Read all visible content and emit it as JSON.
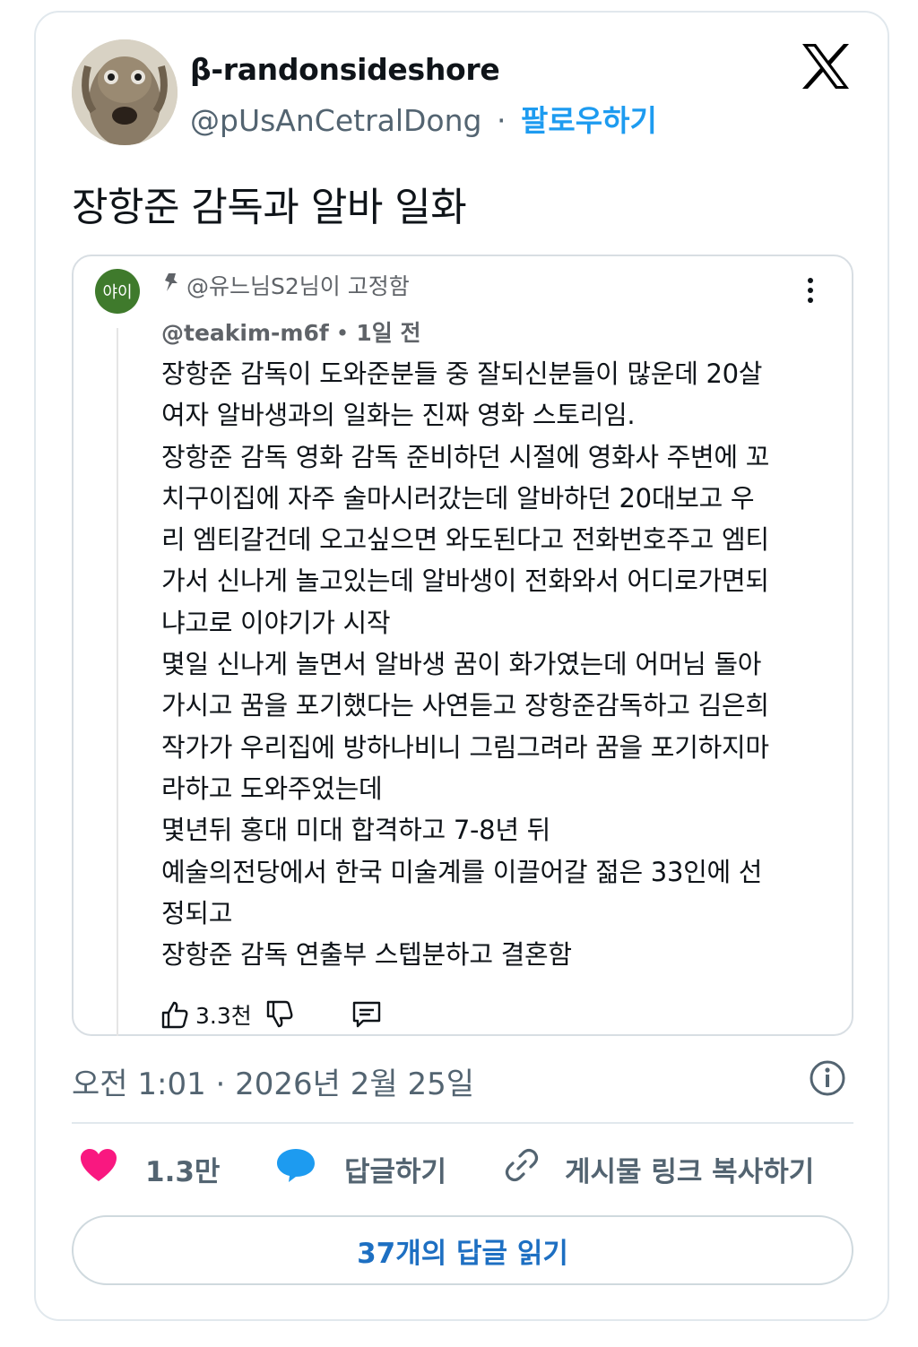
{
  "author": {
    "display_name": "β-randonsideshore",
    "handle": "@pUsAnCetralDong",
    "separator": "·",
    "follow_label": "팔로우하기"
  },
  "tweet": {
    "text": "장항준 감독과 알바 일화"
  },
  "quoted": {
    "avatar_text": "야이",
    "pinned_by": "@유느님S2님이 고정함",
    "handle": "@teakim-m6f",
    "separator": "•",
    "time": "1일 전",
    "lines": [
      "장항준 감독이 도와준분들 중 잘되신분들이 많운데 20살",
      "여자 알바생과의 일화는 진짜 영화 스토리임.",
      "장항준 감독 영화 감독 준비하던 시절에 영화사 주변에 꼬",
      "치구이집에 자주 술마시러갔는데 알바하던 20대보고 우",
      "리 엠티갈건데 오고싶으면 와도된다고 전화번호주고 엠티",
      "가서 신나게 놀고있는데 알바생이 전화와서 어디로가면되",
      "냐고로 이야기가 시작",
      "몇일 신나게 놀면서 알바생 꿈이 화가였는데 어머님 돌아",
      "가시고 꿈을 포기했다는 사연듣고 장항준감독하고 김은희",
      "작가가 우리집에 방하나비니 그림그려라 꿈을 포기하지마",
      "라하고 도와주었는데",
      "몇년뒤 홍대 미대 합격하고 7-8년 뒤",
      "예술의전당에서 한국 미술계를 이끌어갈 젊은 33인에 선",
      "정되고",
      "장항준 감독 연출부 스텝분하고 결혼함"
    ],
    "like_count": "3.3천"
  },
  "timestamp": "오전 1:01 · 2026년 2월 25일",
  "engagement": {
    "like_count": "1.3만",
    "reply_label": "답글하기",
    "copy_link_label": "게시물 링크 복사하기"
  },
  "read_replies_label": "37개의 답글 읽기",
  "colors": {
    "accent": "#1d9bf0",
    "like": "#f91880",
    "reply": "#1d9bf0",
    "button_text": "#1d6fc2"
  }
}
